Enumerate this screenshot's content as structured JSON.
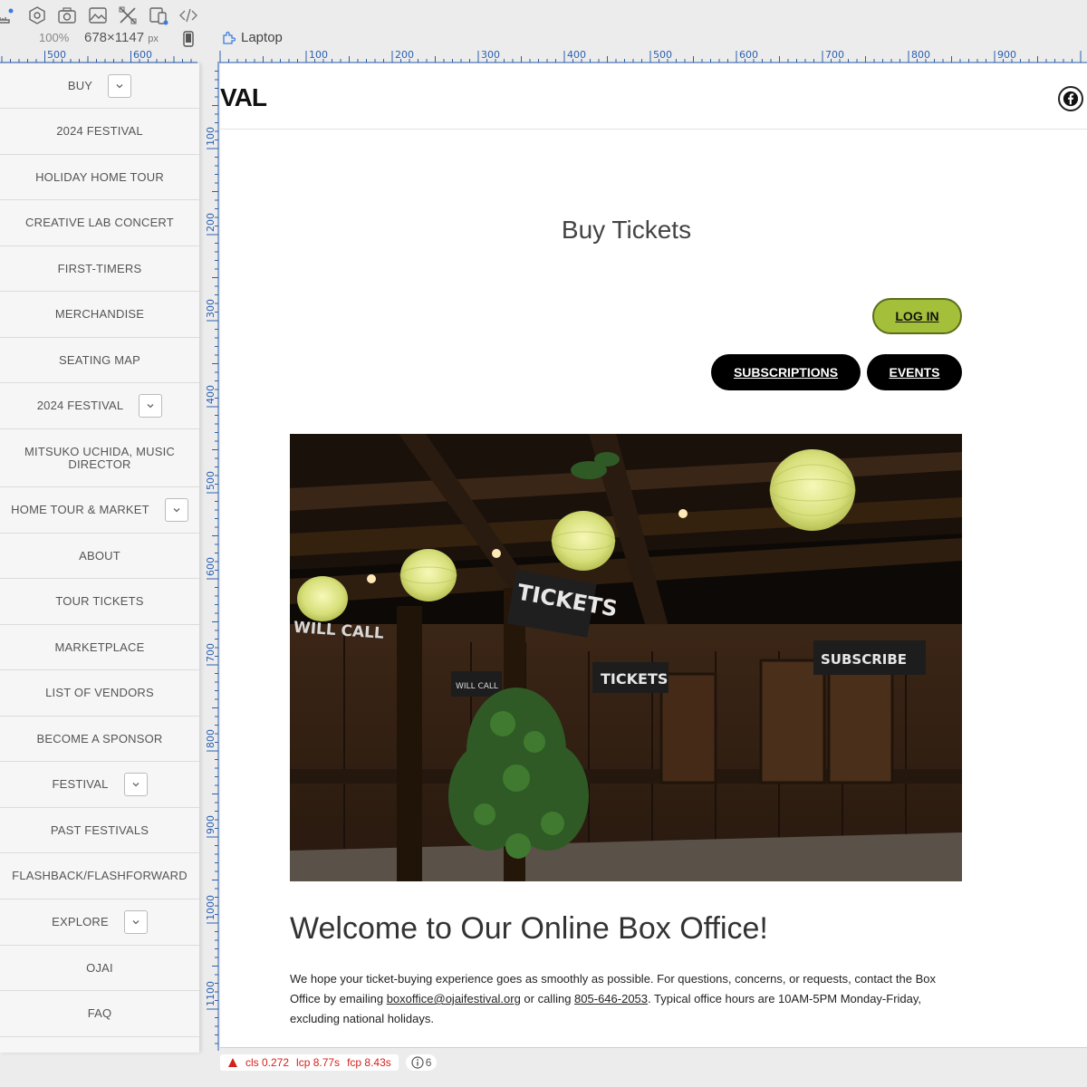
{
  "toolbar": {
    "zoom": "100%",
    "width": "678",
    "times": "×",
    "height": "1147",
    "unit": "px",
    "device": "Laptop",
    "icons": [
      "ruler-icon",
      "settings-icon",
      "camera-icon",
      "image-icon",
      "tools-icon",
      "responsive-icon",
      "code-icon"
    ]
  },
  "rulers": {
    "top_left_labels": [
      "500",
      "600"
    ],
    "top_labels": [
      "100",
      "200",
      "300",
      "400",
      "500",
      "600",
      "700",
      "800",
      "900"
    ],
    "left_labels": [
      "100",
      "200",
      "300",
      "400",
      "500",
      "600",
      "700",
      "800",
      "900",
      "1000",
      "1100"
    ]
  },
  "sidebar": {
    "items": [
      {
        "label": "BUY",
        "dropdown": true
      },
      {
        "label": "2024 FESTIVAL",
        "dropdown": false
      },
      {
        "label": "HOLIDAY HOME TOUR",
        "dropdown": false
      },
      {
        "label": "CREATIVE LAB CONCERT",
        "dropdown": false
      },
      {
        "label": "FIRST-TIMERS",
        "dropdown": false
      },
      {
        "label": "MERCHANDISE",
        "dropdown": false
      },
      {
        "label": "SEATING MAP",
        "dropdown": false
      },
      {
        "label": "2024 FESTIVAL",
        "dropdown": true
      },
      {
        "label": "MITSUKO UCHIDA, MUSIC DIRECTOR",
        "dropdown": false
      },
      {
        "label": "HOME TOUR & MARKET",
        "dropdown": true
      },
      {
        "label": "ABOUT",
        "dropdown": false
      },
      {
        "label": "TOUR TICKETS",
        "dropdown": false
      },
      {
        "label": "MARKETPLACE",
        "dropdown": false
      },
      {
        "label": "LIST OF VENDORS",
        "dropdown": false
      },
      {
        "label": "BECOME A SPONSOR",
        "dropdown": false
      },
      {
        "label": "FESTIVAL",
        "dropdown": true
      },
      {
        "label": "PAST FESTIVALS",
        "dropdown": false
      },
      {
        "label": "FLASHBACK/FLASHFORWARD",
        "dropdown": false
      },
      {
        "label": "EXPLORE",
        "dropdown": true
      },
      {
        "label": "OJAI",
        "dropdown": false
      },
      {
        "label": "FAQ",
        "dropdown": false
      }
    ]
  },
  "header": {
    "logo_fragment": "VAL",
    "social_icon": "facebook-icon"
  },
  "main": {
    "title": "Buy Tickets",
    "login_label": "LOG IN",
    "subscriptions_label": "SUBSCRIPTIONS",
    "events_label": "EVENTS",
    "photo_signs": {
      "tickets_top": "TICKETS",
      "will_call_left": "WILL CALL",
      "will_call_small": "WILL CALL",
      "tickets_mid": "TICKETS",
      "subscribe": "SUBSCRIBE"
    },
    "welcome": "Welcome to Our Online Box Office!",
    "intro_a": "We hope your ticket-buying experience goes as smoothly as possible. For questions, concerns, or requests, contact the Box Office by emailing ",
    "email": "boxoffice@ojaifestival.org",
    "intro_b": " or calling ",
    "phone": "805-646-2053",
    "intro_c": ". Typical office hours are 10AM-5PM Monday-Friday, excluding national holidays."
  },
  "perf": {
    "cls": "cls 0.272",
    "lcp": "lcp 8.77s",
    "fcp": "fcp 8.43s",
    "info_count": "6"
  },
  "colors": {
    "accent_green": "#a4c03b",
    "button_black": "#000000",
    "ruler_blue": "#2b5fb0",
    "perf_red": "#d4221b"
  }
}
